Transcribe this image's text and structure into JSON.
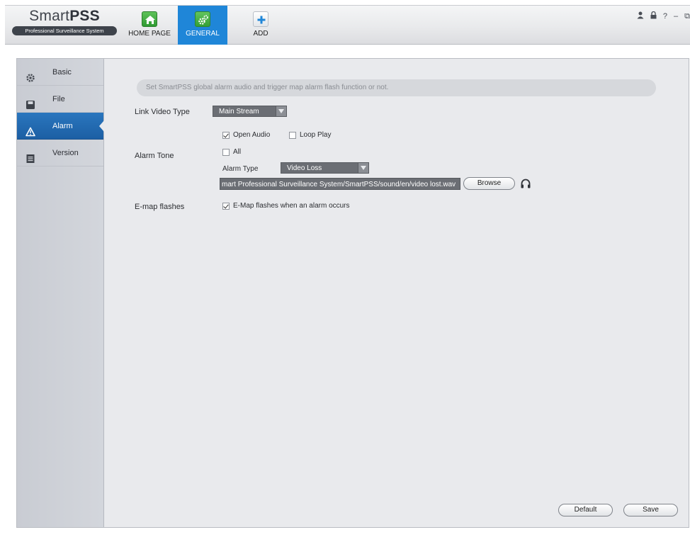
{
  "brand": {
    "name_light": "Smart",
    "name_bold": "PSS",
    "subtitle": "Professional Surveillance System"
  },
  "nav": {
    "tabs": [
      {
        "label": "HOME PAGE",
        "icon": "home-icon"
      },
      {
        "label": "GENERAL",
        "icon": "gears-icon",
        "active": true
      },
      {
        "label": "ADD",
        "icon": "plus-icon"
      }
    ]
  },
  "system_icons": [
    "user-icon",
    "lock-icon",
    "help-icon",
    "minimize-icon",
    "restore-icon"
  ],
  "system_text": {
    "help": "?",
    "minimize": "–",
    "restore": "⧉"
  },
  "sidebar": {
    "items": [
      {
        "label": "Basic",
        "icon": "gear-icon"
      },
      {
        "label": "File",
        "icon": "save-icon"
      },
      {
        "label": "Alarm",
        "icon": "warning-icon",
        "active": true
      },
      {
        "label": "Version",
        "icon": "document-icon"
      }
    ]
  },
  "alarm": {
    "hint": "Set SmartPSS global alarm audio and trigger map alarm flash function or not.",
    "link_video_type": {
      "label": "Link Video Type",
      "value": "Main Stream"
    },
    "open_audio": {
      "label": "Open Audio",
      "checked": true
    },
    "loop_play": {
      "label": "Loop Play",
      "checked": false
    },
    "alarm_tone": {
      "label": "Alarm Tone",
      "all": {
        "label": "All",
        "checked": false
      },
      "alarm_type": {
        "label": "Alarm Type",
        "value": "Video Loss"
      },
      "file_path": "mart Professional Surveillance System/SmartPSS/sound/en/video lost.wav",
      "browse_label": "Browse"
    },
    "emap": {
      "label": "E-map flashes",
      "checkbox_label": "E-Map flashes when an alarm occurs",
      "checked": true
    }
  },
  "footer": {
    "default_label": "Default",
    "save_label": "Save"
  },
  "colors": {
    "accent": "#1f86d8",
    "sidebar_active": "#2a76be",
    "field_bg": "#6b6e74"
  }
}
